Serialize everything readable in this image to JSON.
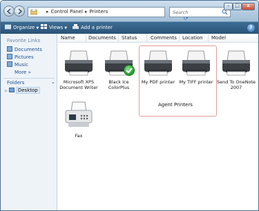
{
  "window": {
    "address_path": [
      "Control Panel",
      "Printers"
    ]
  },
  "search": {
    "placeholder": "Search"
  },
  "window_controls": {
    "minimize": "–",
    "maximize": "□",
    "close": "x"
  },
  "toolbar": {
    "organize": "Organize",
    "views": "Views",
    "add_printer": "Add a printer",
    "help": "?"
  },
  "sidebar": {
    "favorite_links_heading": "Favorite Links",
    "links": [
      "Documents",
      "Pictures",
      "Music"
    ],
    "more": "More »",
    "folders": "Folders",
    "folders_chevron": "⌄",
    "tree": [
      "Desktop"
    ]
  },
  "columns": [
    "Name",
    "Documents",
    "Status",
    "Comments",
    "Location",
    "Model"
  ],
  "items": [
    {
      "label": "Microsoft XPS Document Writer",
      "icon": "printer-icon"
    },
    {
      "label": "Black Ice ColorPlus",
      "icon": "printer-icon",
      "default": true
    },
    {
      "label": "My PDF printer",
      "icon": "printer-icon"
    },
    {
      "label": "My TIFF printer",
      "icon": "printer-icon"
    },
    {
      "label": "Send To OneNote 2007",
      "icon": "printer-icon"
    },
    {
      "label": "Fax",
      "icon": "fax-icon"
    }
  ],
  "group": {
    "label": "Agent Printers"
  },
  "colors": {
    "toolbar": "#2f5a80",
    "link": "#1f4e8c",
    "selection_border": "#e39a9a"
  }
}
